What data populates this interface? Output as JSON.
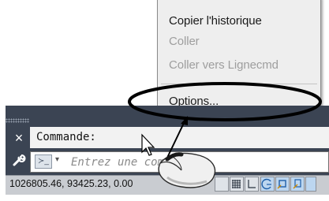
{
  "context_menu": {
    "items": [
      {
        "label": "Copier l'historique",
        "enabled": true
      },
      {
        "label": "Coller",
        "enabled": false
      },
      {
        "label": "Coller vers Lignecmd",
        "enabled": false
      },
      {
        "label": "Options...",
        "enabled": true
      }
    ]
  },
  "command_line": {
    "close_glyph": "×",
    "history_text": "Commande:",
    "prompt_glyph": "≻_",
    "prompt_dropdown": "▾",
    "input_placeholder": "Entrez une commande",
    "settings_glyph": "🔧"
  },
  "status_bar": {
    "coordinates": "1026805.46, 93425.23, 0.00",
    "buttons": [
      "model-space-icon",
      "grid-icon",
      "ortho-icon",
      "polar-icon",
      "osnap-icon",
      "otrack-icon",
      "dynamic-input-icon"
    ]
  },
  "colors": {
    "menu_bg": "#eeeeee",
    "panel_bg": "#3b4453",
    "annotation_stroke": "#000000",
    "disabled_text": "#9e9e9e"
  }
}
